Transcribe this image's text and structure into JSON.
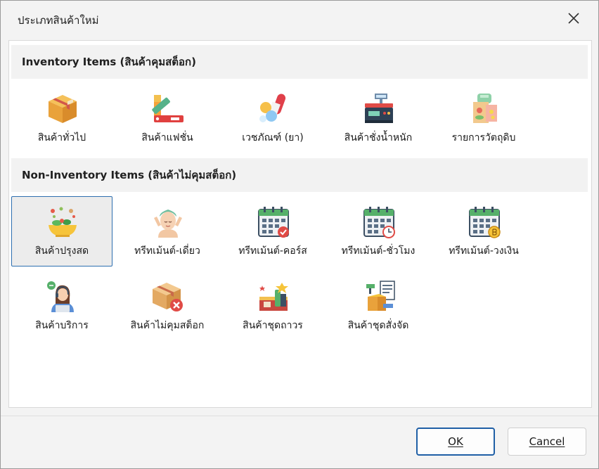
{
  "window": {
    "title": "ประเภทสินค้าใหม่"
  },
  "sections": [
    {
      "title": "Inventory Items (สินค้าคุมสต็อก)",
      "items": [
        {
          "label": "สินค้าทั่วไป",
          "icon": "box-icon"
        },
        {
          "label": "สินค้าแฟชั่น",
          "icon": "color-swatch-icon"
        },
        {
          "label": "เวชภัณฑ์ (ยา)",
          "icon": "pills-icon"
        },
        {
          "label": "สินค้าชั่งน้ำหนัก",
          "icon": "weighing-scale-icon"
        },
        {
          "label": "รายการวัตถุดิบ",
          "icon": "ingredients-icon"
        }
      ]
    },
    {
      "title": "Non-Inventory Items (สินค้าไม่คุมสต็อก)",
      "items": [
        {
          "label": "สินค้าปรุงสด",
          "icon": "salad-bowl-icon",
          "selected": true
        },
        {
          "label": "ทรีทเม้นต์-เดี่ยว",
          "icon": "spa-treatment-icon"
        },
        {
          "label": "ทรีทเม้นต์-คอร์ส",
          "icon": "calendar-check-icon"
        },
        {
          "label": "ทรีทเม้นต์-ชั่วโมง",
          "icon": "calendar-clock-icon"
        },
        {
          "label": "ทรีทเม้นต์-วงเงิน",
          "icon": "calendar-coin-icon"
        },
        {
          "label": "สินค้าบริการ",
          "icon": "customer-service-icon"
        },
        {
          "label": "สินค้าไม่คุมสต็อก",
          "icon": "box-cancel-icon"
        },
        {
          "label": "สินค้าชุดถาวร",
          "icon": "product-bundle-icon"
        },
        {
          "label": "สินค้าชุดสั่งจัด",
          "icon": "custom-package-icon"
        }
      ]
    }
  ],
  "buttons": {
    "ok": "OK",
    "cancel": "Cancel"
  },
  "colors": {
    "selection_border": "#2e6fb0",
    "primary_button_border": "#1f5fa6"
  }
}
